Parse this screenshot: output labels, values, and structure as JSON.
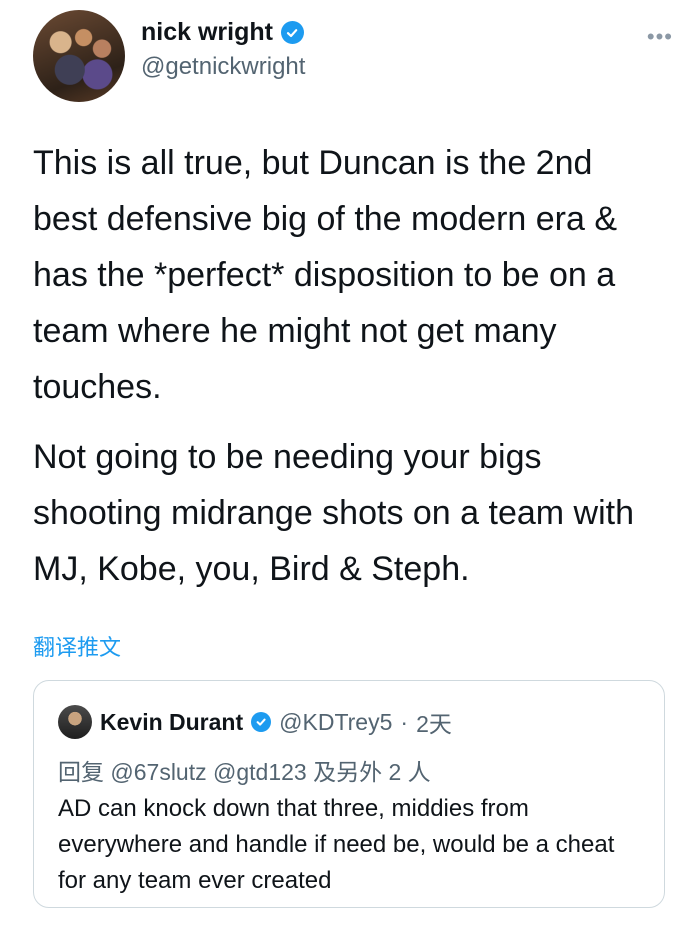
{
  "author": {
    "display_name": "nick wright",
    "handle": "@getnickwright"
  },
  "more_label": "•••",
  "tweet": {
    "paragraphs": [
      "This is all true, but Duncan is the 2nd best defensive big of the modern era & has the *perfect* disposition to be on a team where he might not get many touches.",
      "Not going to be needing your bigs shooting midrange shots on a team with MJ, Kobe, you, Bird & Steph."
    ]
  },
  "translate_label": "翻译推文",
  "quoted_tweet": {
    "display_name": "Kevin Durant",
    "handle": "@KDTrey5",
    "separator": "·",
    "time": "2天",
    "reply_to": "回复 @67slutz @gtd123 及另外 2 人",
    "text": "AD can knock down that three, middies from everywhere and handle if need be, would be a cheat for any team ever created"
  },
  "colors": {
    "accent": "#1d9bf0",
    "text": "#0f1419",
    "secondary_text": "#536471"
  },
  "icons": {
    "verified": "verified-badge-icon",
    "more": "more-options-icon"
  }
}
